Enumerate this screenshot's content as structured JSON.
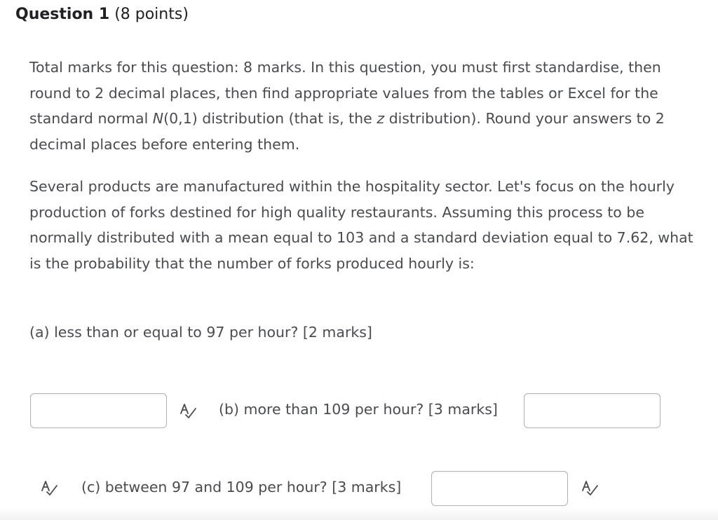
{
  "question": {
    "title": "Question 1",
    "points": "(8 points)"
  },
  "intro": {
    "text_1": "Total marks for this question: 8 marks. In this question, you must first standardise, then round to 2 decimal places, then find appropriate values from the tables or Excel for the standard normal ",
    "dist_name": "N",
    "text_2": "(0,1) distribution (that is, the ",
    "z_symbol": "z",
    "text_3": " distribution). Round your answers to 2 decimal places before entering them."
  },
  "scenario": {
    "text": "Several products are manufactured within the hospitality sector. Let's focus on the hourly production of forks destined for high quality restaurants. Assuming this process to be normally distributed with a mean equal to 103 and a standard deviation equal to 7.62, what is the probability that the number of forks produced hourly is:"
  },
  "parts": {
    "a_label": "(a) less than or equal to 97 per hour? [2 marks]",
    "b_label": "(b) more than 109 per hour? [3 marks]",
    "c_label": "(c) between 97 and 109 per hour? [3 marks]",
    "a_value": "",
    "b_value": "",
    "c_value": ""
  },
  "icons": {
    "spellcheck": "spellcheck-icon"
  },
  "colors": {
    "text": "#494c4e",
    "heading": "#202122",
    "input_border": "#b3b3b3"
  }
}
